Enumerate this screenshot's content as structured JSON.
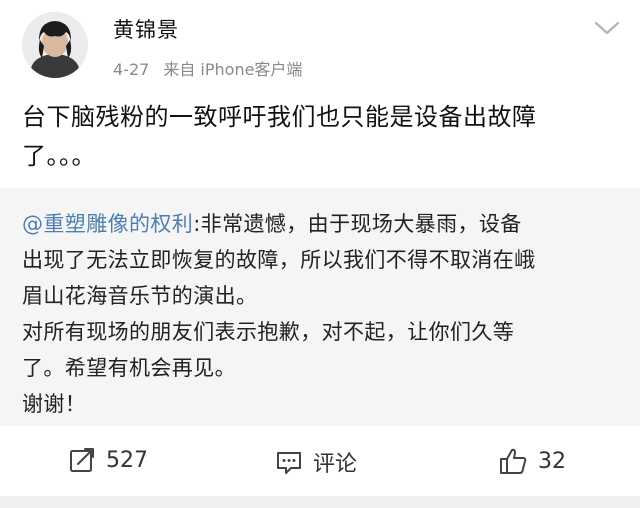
{
  "post": {
    "username": "黄锦景",
    "date": "4-27",
    "source_prefix": "来自",
    "source_device": "iPhone客户端",
    "text_line1": "台下脑残粉的一致呼吁我们也只能是设备出故障",
    "text_line2": "了。。。"
  },
  "repost": {
    "mention": "@重塑雕像的权利",
    "line1_rest": ":非常遗憾，由于现场大暴雨，设备",
    "line2": "出现了无法立即恢复的故障，所以我们不得不取消在峨",
    "line3": "眉山花海音乐节的演出。",
    "line4": "对所有现场的朋友们表示抱歉，对不起，让你们久等",
    "line5": "了。希望有机会再见。",
    "line6": "谢谢！"
  },
  "actions": {
    "repost_count": "527",
    "comment_label": "评论",
    "like_count": "32"
  },
  "icons": {
    "expand": "chevron-down-icon",
    "repost": "repost-icon",
    "comment": "comment-icon",
    "like": "thumbs-up-icon"
  },
  "colors": {
    "mention": "#4f7fb0",
    "meta_text": "#8a8a8a",
    "repost_bg": "#f5f5f5"
  }
}
